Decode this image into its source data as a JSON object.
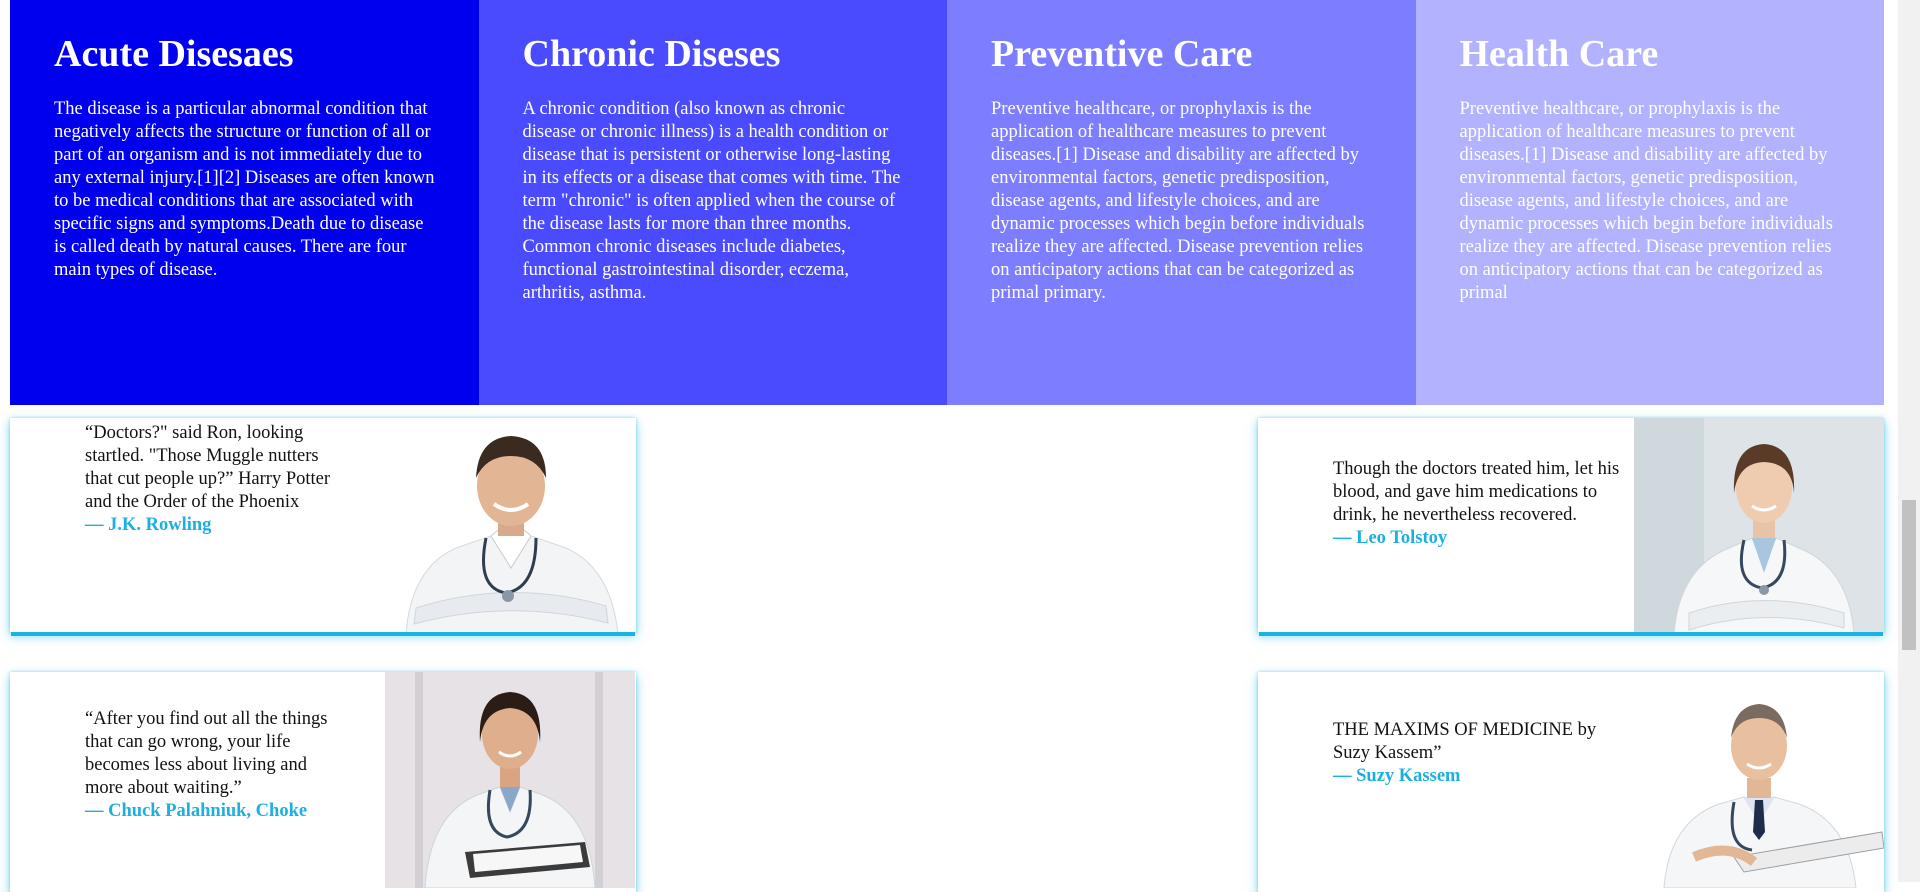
{
  "features": [
    {
      "title": "Acute Disesaes",
      "text": "The disease is a particular abnormal condition that negatively affects the structure or function of all or part of an organism and is not immediately due to any external injury.[1][2] Diseases are often known to be medical conditions that are associated with specific signs and symptoms.Death due to disease is called death by natural causes. There are four main types of disease.",
      "bg": "#0000ee"
    },
    {
      "title": "Chronic Diseses",
      "text": "A chronic condition (also known as chronic disease or chronic illness) is a health condition or disease that is persistent or otherwise long-lasting in its effects or a disease that comes with time. The term \"chronic\" is often applied when the course of the disease lasts for more than three months. Common chronic diseases include diabetes, functional gastrointestinal disorder, eczema, arthritis, asthma.",
      "bg": "#4a4aff"
    },
    {
      "title": "Preventive Care",
      "text": "Preventive healthcare, or prophylaxis is the application of healthcare measures to prevent diseases.[1] Disease and disability are affected by environmental factors, genetic predisposition, disease agents, and lifestyle choices, and are dynamic processes which begin before individuals realize they are affected. Disease prevention relies on anticipatory actions that can be categorized as primal primary.",
      "bg": "#7d7dff"
    },
    {
      "title": "Health Care",
      "text": "Preventive healthcare, or prophylaxis is the application of healthcare measures to prevent diseases.[1] Disease and disability are affected by environmental factors, genetic predisposition, disease agents, and lifestyle choices, and are dynamic processes which begin before individuals realize they are affected. Disease prevention relies on anticipatory actions that can be categorized as primal",
      "bg": "#b2b2ff"
    }
  ],
  "testimonials": [
    {
      "quote": "“Doctors?\" said Ron, looking startled. \"Those Muggle nutters that cut people up?” Harry Potter and the Order of the Phoenix",
      "author": "— J.K. Rowling",
      "photo": "male-doctor-arms-crossed"
    },
    {
      "quote": "Though the doctors treated him, let his blood, and gave him medications to drink, he nevertheless recovered.",
      "author": "— Leo Tolstoy",
      "photo": "female-doctor-arms-crossed"
    },
    {
      "quote": "“After you find out all the things that can go wrong, your life becomes less about living and more about waiting.”",
      "author": "— Chuck Palahniuk, Choke",
      "photo": "female-doctor-clipboard"
    },
    {
      "quote": "THE MAXIMS OF MEDICINE by Suzy Kassem”",
      "author": "— Suzy Kassem",
      "photo": "senior-male-doctor-clipboard"
    }
  ],
  "colors": {
    "accent": "#17b5e6",
    "author": "#1cb0e0"
  }
}
